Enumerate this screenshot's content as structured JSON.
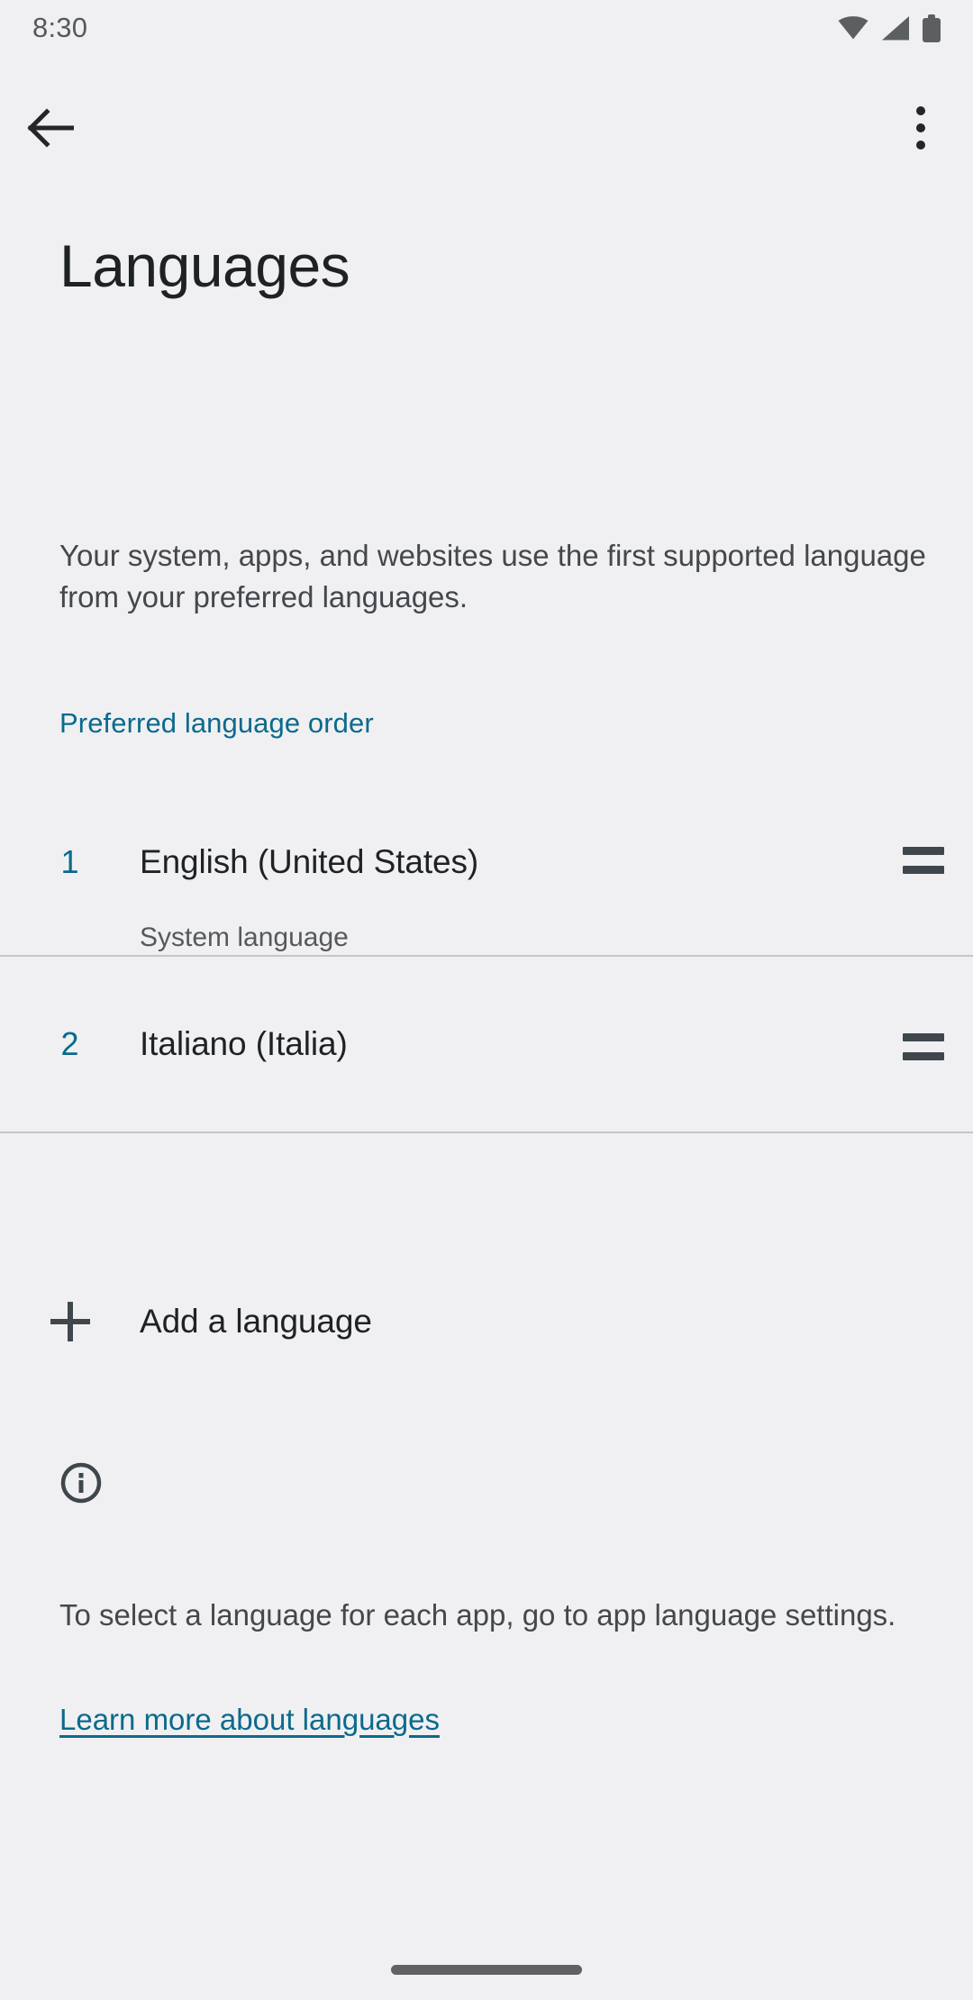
{
  "status_bar": {
    "time": "8:30",
    "icons": [
      "wifi-icon",
      "cell-signal-icon",
      "battery-icon"
    ]
  },
  "app_bar": {
    "back_icon": "arrow-back-icon",
    "overflow_icon": "more-vert-icon"
  },
  "header": {
    "title": "Languages",
    "description": "Your system, apps, and websites use the first supported language from your preferred languages."
  },
  "section": {
    "label": "Preferred language order"
  },
  "languages": [
    {
      "number": "1",
      "name": "English (United States)",
      "subtitle": "System language",
      "drag_handle": "drag-handle-icon"
    },
    {
      "number": "2",
      "name": "Italiano (Italia)",
      "subtitle": "",
      "drag_handle": "drag-handle-icon"
    }
  ],
  "add_language": {
    "icon": "plus-icon",
    "label": "Add a language"
  },
  "footer": {
    "icon": "info-circle-icon",
    "text": "To select a language for each app, go to app language settings.",
    "link": "Learn more about languages"
  },
  "colors": {
    "background": "#f0f0f2",
    "accent": "#0b6a8c",
    "primary_text": "#1e2225",
    "secondary_text": "#44484c",
    "divider": "#c6c6c8",
    "icon": "#3f474d"
  }
}
